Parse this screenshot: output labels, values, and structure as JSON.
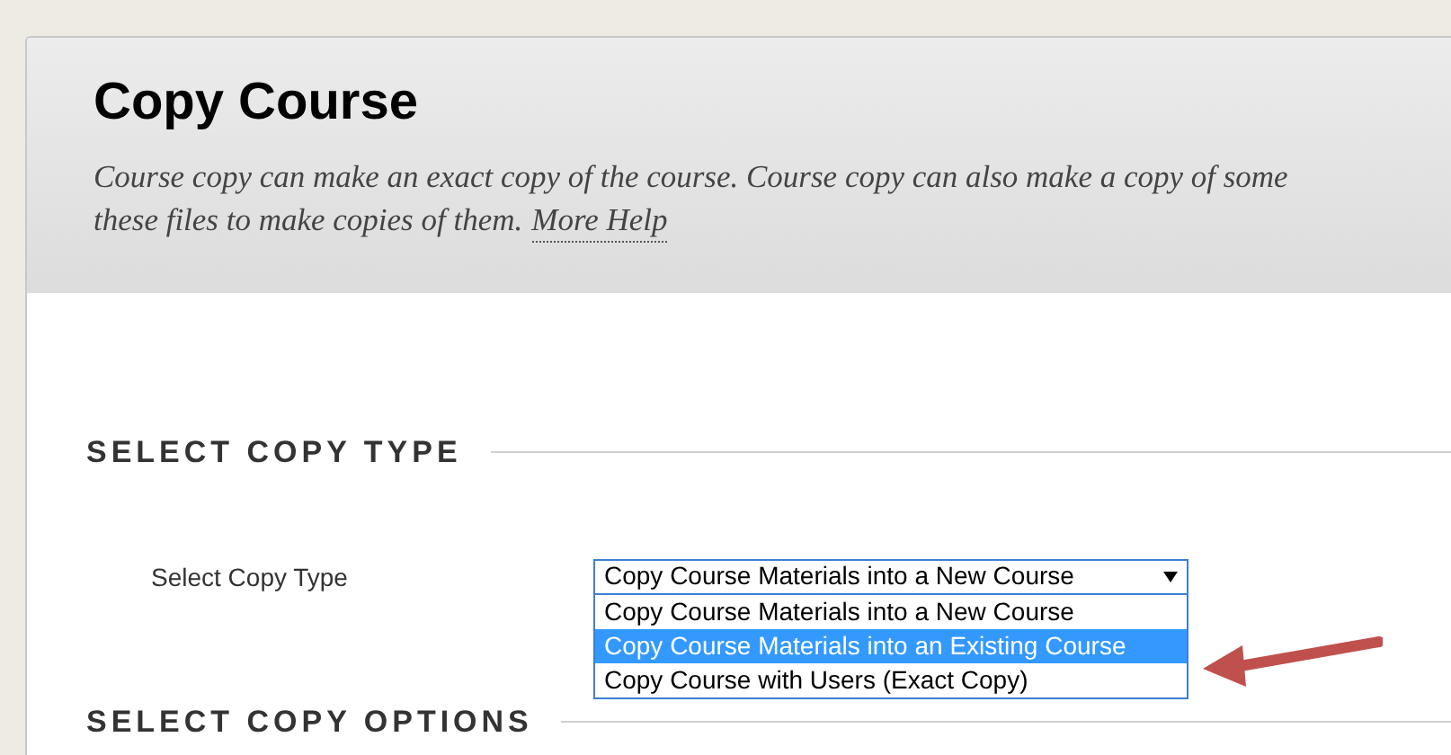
{
  "page_header": {
    "title": "Copy Course",
    "description_lines": [
      "Course copy can make an exact copy of the course. Course copy can also make a copy of some",
      "these files to make copies of them."
    ],
    "help_link": "More Help"
  },
  "sections": [
    {
      "heading": "SELECT COPY TYPE",
      "field": {
        "label": "Select Copy Type",
        "value": "Copy Course Materials into a New Course",
        "expanded": true,
        "options": [
          {
            "label": "Copy Course Materials into a New Course",
            "highlighted": false
          },
          {
            "label": "Copy Course Materials into an Existing Course",
            "highlighted": true
          },
          {
            "label": "Copy Course with Users (Exact Copy)",
            "highlighted": false
          }
        ]
      }
    },
    {
      "heading": "SELECT COPY OPTIONS"
    }
  ]
}
